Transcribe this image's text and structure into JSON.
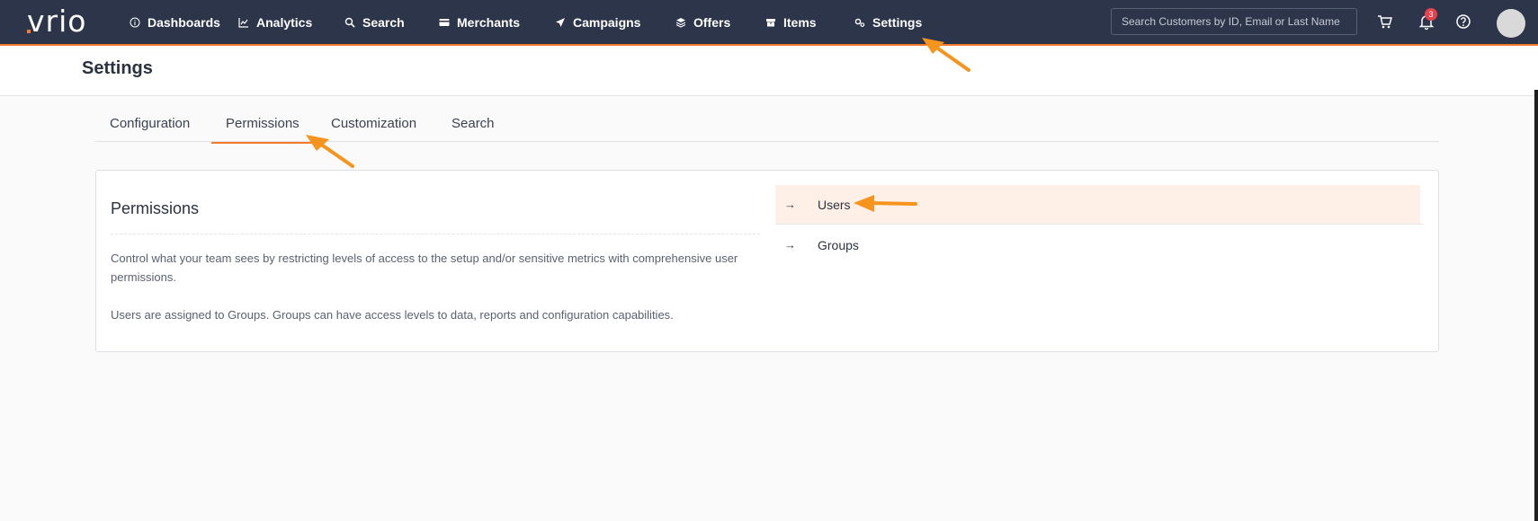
{
  "app": {
    "logo_text": "vrio",
    "brand_color": "#f37b2b",
    "nav_bg": "#2c3549"
  },
  "nav": {
    "items": [
      {
        "label": "Dashboards",
        "icon": "info-circle-icon"
      },
      {
        "label": "Analytics",
        "icon": "line-chart-icon"
      },
      {
        "label": "Search",
        "icon": "search-icon"
      },
      {
        "label": "Merchants",
        "icon": "credit-card-icon"
      },
      {
        "label": "Campaigns",
        "icon": "paper-plane-icon"
      },
      {
        "label": "Offers",
        "icon": "layers-icon"
      },
      {
        "label": "Items",
        "icon": "box-icon"
      },
      {
        "label": "Settings",
        "icon": "gears-icon",
        "active": true
      }
    ],
    "search_placeholder": "Search Customers by ID, Email or Last Name",
    "notification_count": "3"
  },
  "page": {
    "title": "Settings"
  },
  "tabs": [
    {
      "label": "Configuration"
    },
    {
      "label": "Permissions",
      "active": true
    },
    {
      "label": "Customization"
    },
    {
      "label": "Search"
    }
  ],
  "permissions": {
    "title": "Permissions",
    "description_1": "Control what your team sees by restricting levels of access to the setup and/or sensitive metrics with comprehensive user permissions.",
    "description_2": "Users are assigned to Groups. Groups can have access levels to data, reports and configuration capabilities.",
    "links": [
      {
        "label": "Users",
        "arrow": "→",
        "highlighted": true
      },
      {
        "label": "Groups",
        "arrow": "→"
      }
    ]
  },
  "annotation": {
    "arrow_color": "#f7941d"
  }
}
